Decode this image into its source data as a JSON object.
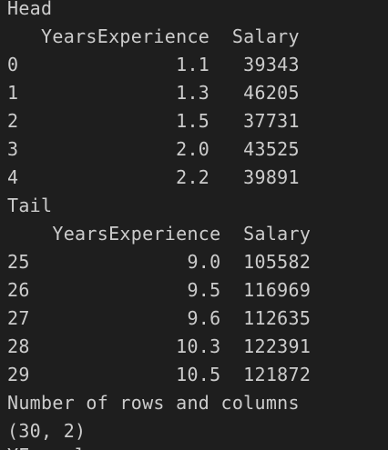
{
  "output": {
    "head_label": "Head",
    "head_header": "   YearsExperience  Salary",
    "head_rows": [
      "0              1.1   39343",
      "1              1.3   46205",
      "2              1.5   37731",
      "3              2.0   43525",
      "4              2.2   39891"
    ],
    "tail_label": "Tail",
    "tail_header": "    YearsExperience  Salary",
    "tail_rows": [
      "25              9.0  105582",
      "26              9.5  116969",
      "27              9.6  112635",
      "28             10.3  122391",
      "29             10.5  121872"
    ],
    "shape_label": "Number of rows and columns",
    "shape_value": "(30, 2)",
    "cut_line": "YE    l"
  }
}
